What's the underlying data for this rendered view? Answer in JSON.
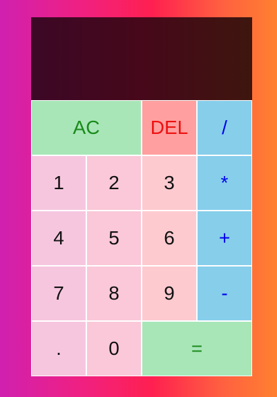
{
  "display": {
    "previous_operand": "",
    "current_operand": ""
  },
  "buttons": {
    "ac": {
      "label": "AC",
      "bg": "#a8e6b8",
      "color": "#1a8a1a"
    },
    "del": {
      "label": "DEL",
      "bg": "#ff9f9f",
      "color": "#ee1111"
    },
    "divide": {
      "label": "/",
      "bg": "#87ceeb",
      "color": "#0000ee"
    },
    "one": {
      "label": "1",
      "bg": "#f6c6df"
    },
    "two": {
      "label": "2",
      "bg": "#fac8d8"
    },
    "three": {
      "label": "3",
      "bg": "#fdcad0"
    },
    "multiply": {
      "label": "*",
      "bg": "#87ceeb",
      "color": "#0000ee"
    },
    "four": {
      "label": "4",
      "bg": "#f6c6df"
    },
    "five": {
      "label": "5",
      "bg": "#fac8d8"
    },
    "six": {
      "label": "6",
      "bg": "#fdcad0"
    },
    "plus": {
      "label": "+",
      "bg": "#87ceeb",
      "color": "#0000ee"
    },
    "seven": {
      "label": "7",
      "bg": "#f6c6df"
    },
    "eight": {
      "label": "8",
      "bg": "#fac8d8"
    },
    "nine": {
      "label": "9",
      "bg": "#fdcad0"
    },
    "minus": {
      "label": "-",
      "bg": "#87ceeb",
      "color": "#0000ee"
    },
    "decimal": {
      "label": ".",
      "bg": "#f6c6df"
    },
    "zero": {
      "label": "0",
      "bg": "#fac8d8"
    },
    "equals": {
      "label": "=",
      "bg": "#a8e6b8",
      "color": "#1a8a1a"
    }
  }
}
